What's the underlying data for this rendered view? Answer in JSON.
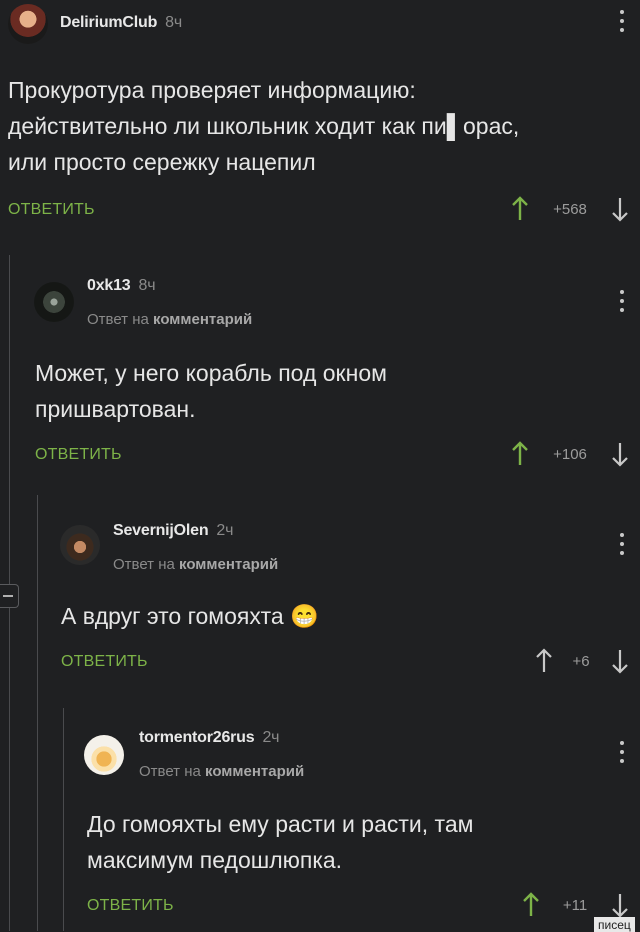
{
  "comments": [
    {
      "username": "DeliriumClub",
      "time": "8ч",
      "reply_to": "",
      "text_lines": [
        "Прокуротура проверяет информацию:",
        "действительно ли школьник ходит как пи▌орас,",
        "или просто сережку нацепил"
      ],
      "reply_label": "ОТВЕТИТЬ",
      "score": "+568",
      "upvoted": true
    },
    {
      "username": "0xk13",
      "time": "8ч",
      "reply_to_prefix": "Ответ на",
      "reply_to_bold": "комментарий",
      "text_lines": [
        "Может, у него корабль под окном",
        "пришвартован."
      ],
      "reply_label": "ОТВЕТИТЬ",
      "score": "+106",
      "upvoted": true
    },
    {
      "username": "SevernijOlen",
      "time": "2ч",
      "reply_to_prefix": "Ответ на",
      "reply_to_bold": "комментарий",
      "text_lines": [
        "А вдруг это гомояхта 😁"
      ],
      "reply_label": "ОТВЕТИТЬ",
      "score": "+6",
      "upvoted": false
    },
    {
      "username": "tormentor26rus",
      "time": "2ч",
      "reply_to_prefix": "Ответ на",
      "reply_to_bold": "комментарий",
      "text_lines": [
        "До гомояхты ему расти и расти, там",
        "максимум педошлюпка."
      ],
      "reply_label": "ОТВЕТИТЬ",
      "score": "+11",
      "upvoted": true
    }
  ],
  "watermark": "писец",
  "colors": {
    "background": "#1f2022",
    "accent_green": "#7db348",
    "text": "#e6e6e6",
    "muted": "#8a8a8a"
  },
  "icons": [
    "avatar",
    "more-vert-icon",
    "arrow-up-icon",
    "arrow-down-icon",
    "collapse-thread-icon"
  ]
}
